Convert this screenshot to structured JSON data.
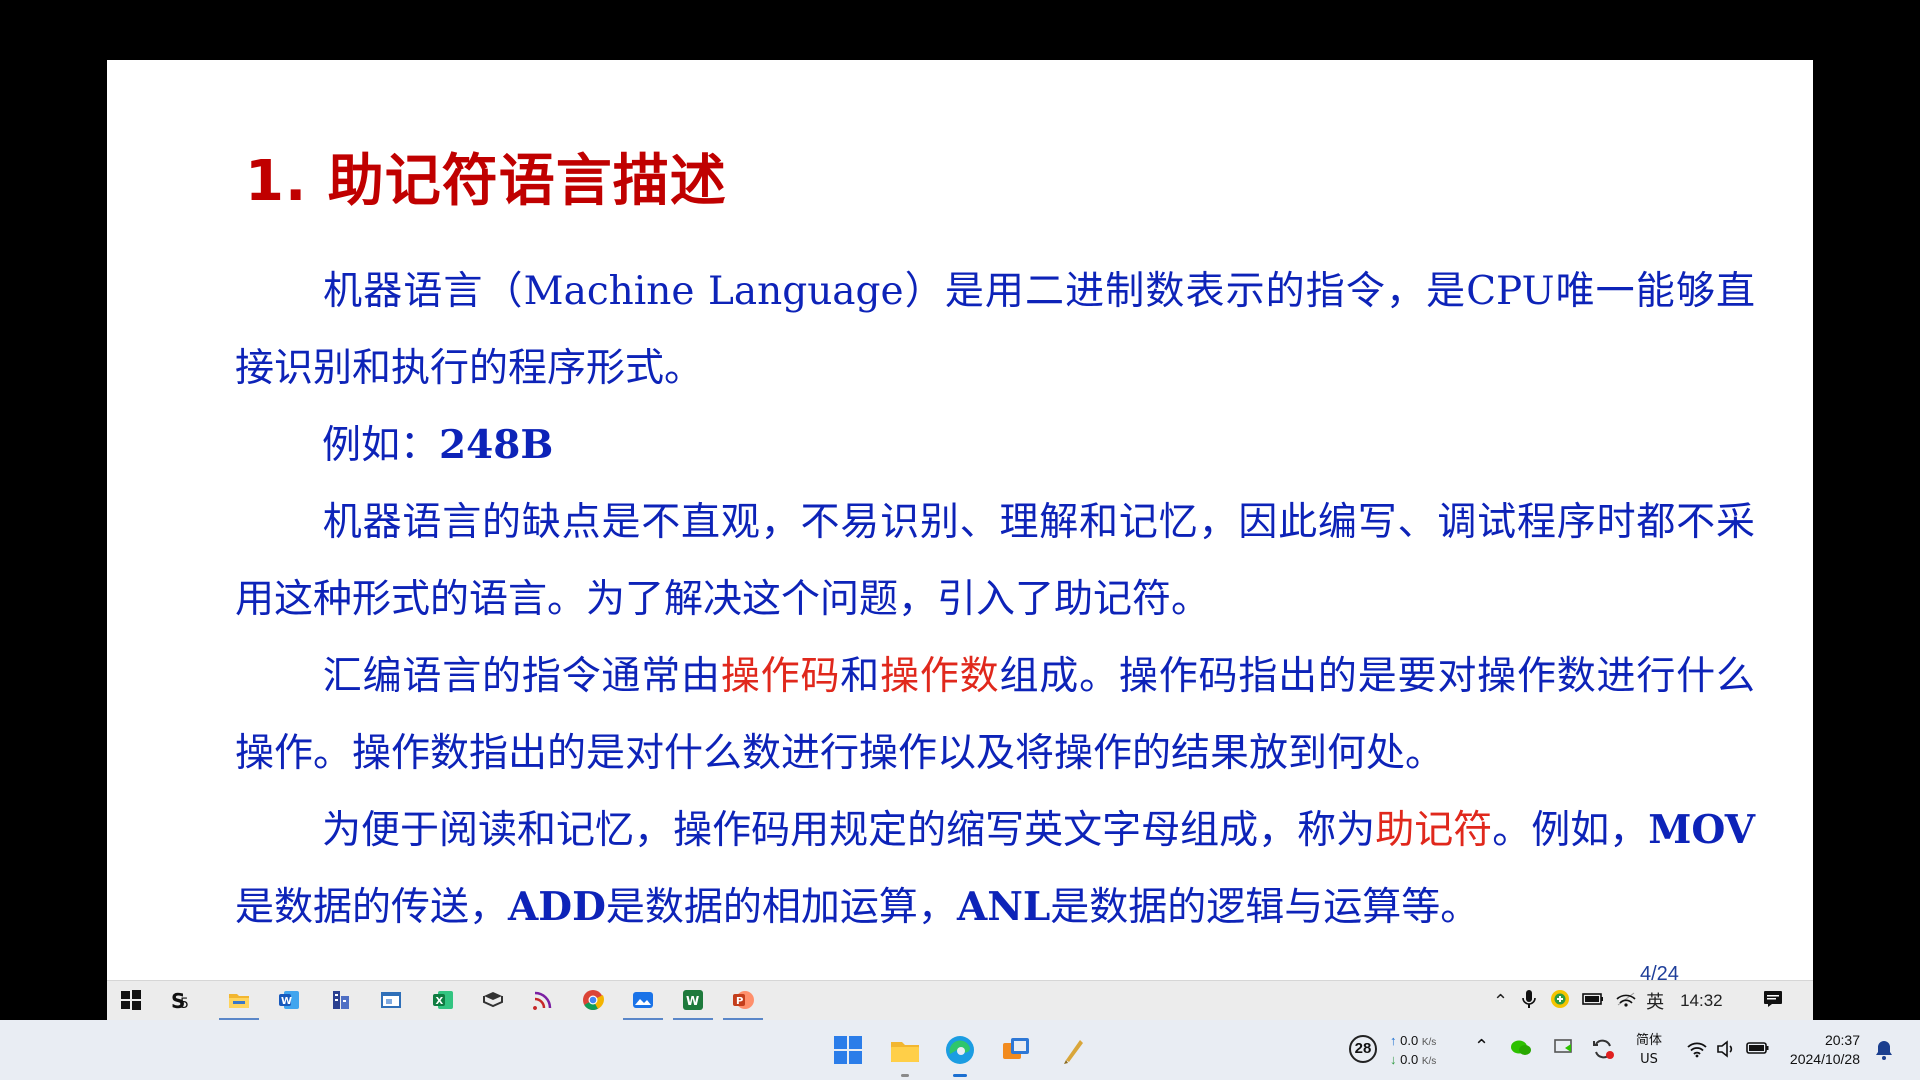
{
  "slide": {
    "title": "1. 助记符语言描述",
    "p1": {
      "text": "机器语言（Machine Language）是用二进制数表示的指令，是CPU唯一能够直接识别和执行的程序形式。"
    },
    "p2": {
      "prefix": "例如：",
      "code": "248B"
    },
    "p3": {
      "text": "机器语言的缺点是不直观，不易识别、理解和记忆，因此编写、调试程序时都不采用这种形式的语言。为了解决这个问题，引入了助记符。"
    },
    "p4": {
      "t1": "汇编语言的指令通常由",
      "opcode": "操作码",
      "t2": "和",
      "operand": "操作数",
      "t3": "组成。操作码指出的是要对操作数进行什么操作。操作数指出的是对什么数进行操作以及将操作的结果放到何处。"
    },
    "p5": {
      "t1": "为便于阅读和记忆，操作码用规定的缩写英文字母组成，称为",
      "mnemonic": "助记符",
      "t2": "。例如，",
      "mov": "MOV",
      "t3": "是数据的传送，",
      "add": "ADD",
      "t4": "是数据的相加运算，",
      "anl": "ANL",
      "t5": "是数据的逻辑与运算等。"
    },
    "page": "4/24"
  },
  "inner_taskbar": {
    "apps": [
      "start-icon",
      "sogou-icon",
      "file-explorer-icon",
      "word-icon",
      "building-icon",
      "window-icon",
      "excel-icon",
      "book-icon",
      "rss-icon",
      "chrome-icon",
      "photos-icon",
      "wps-icon",
      "powerpoint-icon"
    ],
    "ime": "英",
    "time": "14:32"
  },
  "host_taskbar": {
    "apps": [
      "windows-start-icon",
      "file-explorer-icon",
      "edge-icon",
      "remote-desktop-icon",
      "pen-tool-icon"
    ],
    "cpu_badge": "28",
    "net_up": "0.0",
    "net_down": "0.0",
    "net_unit": "K/s",
    "lang_primary": "简体",
    "lang_secondary": "US",
    "time": "20:37",
    "date": "2024/10/28"
  },
  "colors": {
    "title": "#c00000",
    "body_text": "#0d23b8",
    "highlight": "#e0281c"
  }
}
